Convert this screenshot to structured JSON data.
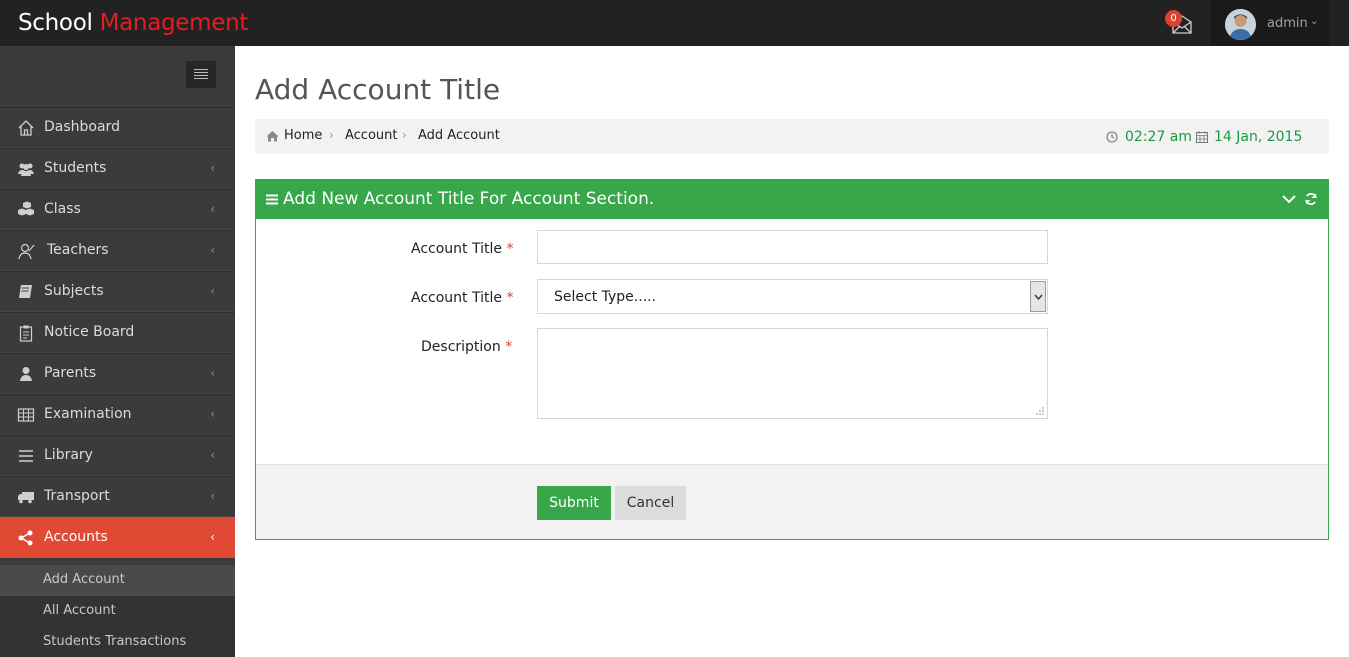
{
  "brand": {
    "part1": "School ",
    "part2": "Management"
  },
  "header": {
    "mail_count": "0",
    "username": "admin"
  },
  "sidebar": {
    "items": [
      {
        "label": "Dashboard",
        "icon": "home-icon"
      },
      {
        "label": "Students",
        "icon": "users-icon"
      },
      {
        "label": "Class",
        "icon": "cubes-icon"
      },
      {
        "label": "Teachers",
        "icon": "teacher-icon"
      },
      {
        "label": "Subjects",
        "icon": "book-icon"
      },
      {
        "label": "Notice Board",
        "icon": "clipboard-icon"
      },
      {
        "label": "Parents",
        "icon": "user-icon"
      },
      {
        "label": "Examination",
        "icon": "table-icon"
      },
      {
        "label": "Library",
        "icon": "list-icon"
      },
      {
        "label": "Transport",
        "icon": "truck-icon"
      },
      {
        "label": "Accounts",
        "icon": "share-icon"
      }
    ],
    "submenu": [
      "Add Account",
      "All Account",
      "Students Transactions"
    ]
  },
  "page": {
    "title": "Add Account Title"
  },
  "breadcrumb": {
    "home": "Home",
    "section": "Account",
    "current": "Add Account"
  },
  "clock": {
    "time": "02:27 am",
    "date": "14 Jan, 2015"
  },
  "panel": {
    "title": "Add New Account Title For Account Section."
  },
  "form": {
    "field1_label": "Account Title",
    "field2_label": "Account Title",
    "field2_value": "Select Type.....",
    "field3_label": "Description",
    "required_mark": "*",
    "submit": "Submit",
    "cancel": "Cancel"
  },
  "colors": {
    "accent_green": "#37a74a",
    "active_red": "#e04a35",
    "brand_red": "#e51c23",
    "date_green": "#1b9a42"
  }
}
